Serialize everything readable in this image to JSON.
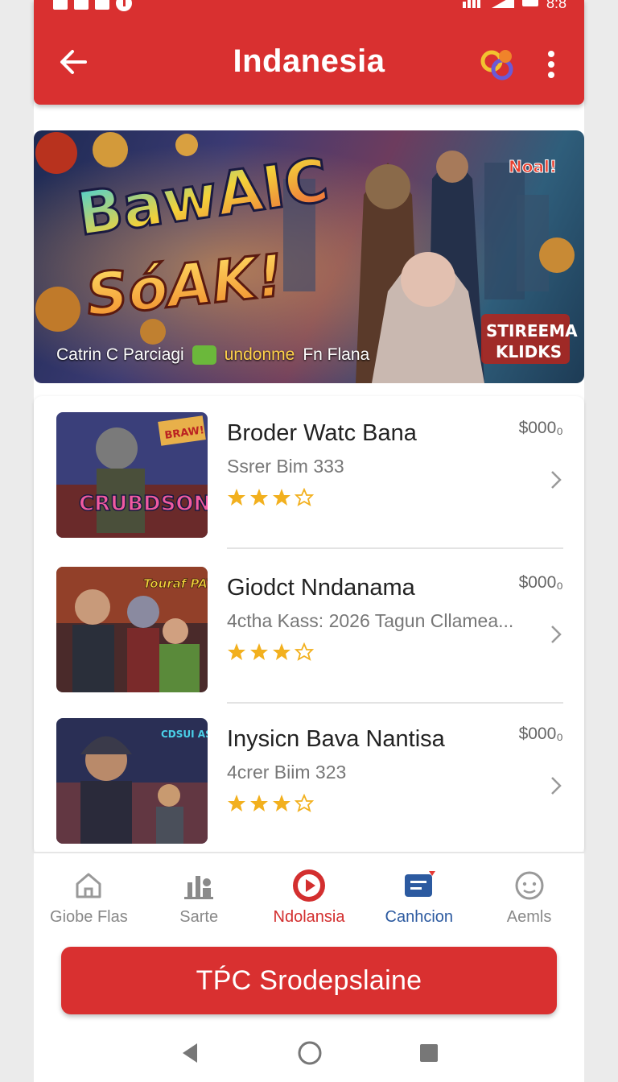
{
  "status": {
    "time": "8:8"
  },
  "header": {
    "title": "Indanesia"
  },
  "banner": {
    "headline_line1": "BawAIC",
    "headline_line2": "SóAK!",
    "badge_top": "Noal!",
    "badge_bottom_line1": "STIREEMA",
    "badge_bottom_line2": "KLIDKS",
    "caption_left": "Catrin C Parciagi",
    "caption_mid": "undonme",
    "caption_right": "Fn Flana"
  },
  "games": [
    {
      "title": "Broder Watc Bana",
      "subtitle": "Ssrer Bim 333",
      "price": "$000₀",
      "rating": 3,
      "thumb_text": "CRUBDSON",
      "thumb_tag": "BRAW!",
      "colors": [
        "#3a3f7a",
        "#9b3b2f",
        "#d9a23a"
      ]
    },
    {
      "title": "Giodct Nndanama",
      "subtitle": "4ctha Kass: 2026 Tagun Cllamea...",
      "price": "$000₀",
      "rating": 3,
      "thumb_text": "",
      "thumb_tag": "Touraf PAYKEIN",
      "colors": [
        "#4a2a2a",
        "#b04a2a",
        "#e0a040"
      ]
    },
    {
      "title": "Inysicn Bava Nantisa",
      "subtitle": "4crer Biim 323",
      "price": "$000₀",
      "rating": 3,
      "thumb_text": "",
      "thumb_tag": "CDSUI ASEHA",
      "colors": [
        "#2a2f55",
        "#7a3a6a",
        "#d07a3a"
      ]
    }
  ],
  "tabs": [
    {
      "label": "Giobe Flas",
      "icon": "home-icon"
    },
    {
      "label": "Sarte",
      "icon": "stats-icon"
    },
    {
      "label": "Ndolansia",
      "icon": "play-icon"
    },
    {
      "label": "Canhcion",
      "icon": "message-icon"
    },
    {
      "label": "Aemls",
      "icon": "face-icon"
    }
  ],
  "cta": {
    "label": "TṔC Srodepslaine"
  },
  "theme": {
    "primary": "#d93030",
    "accent_blue": "#2c5aa0",
    "star": "#f2b01e"
  }
}
